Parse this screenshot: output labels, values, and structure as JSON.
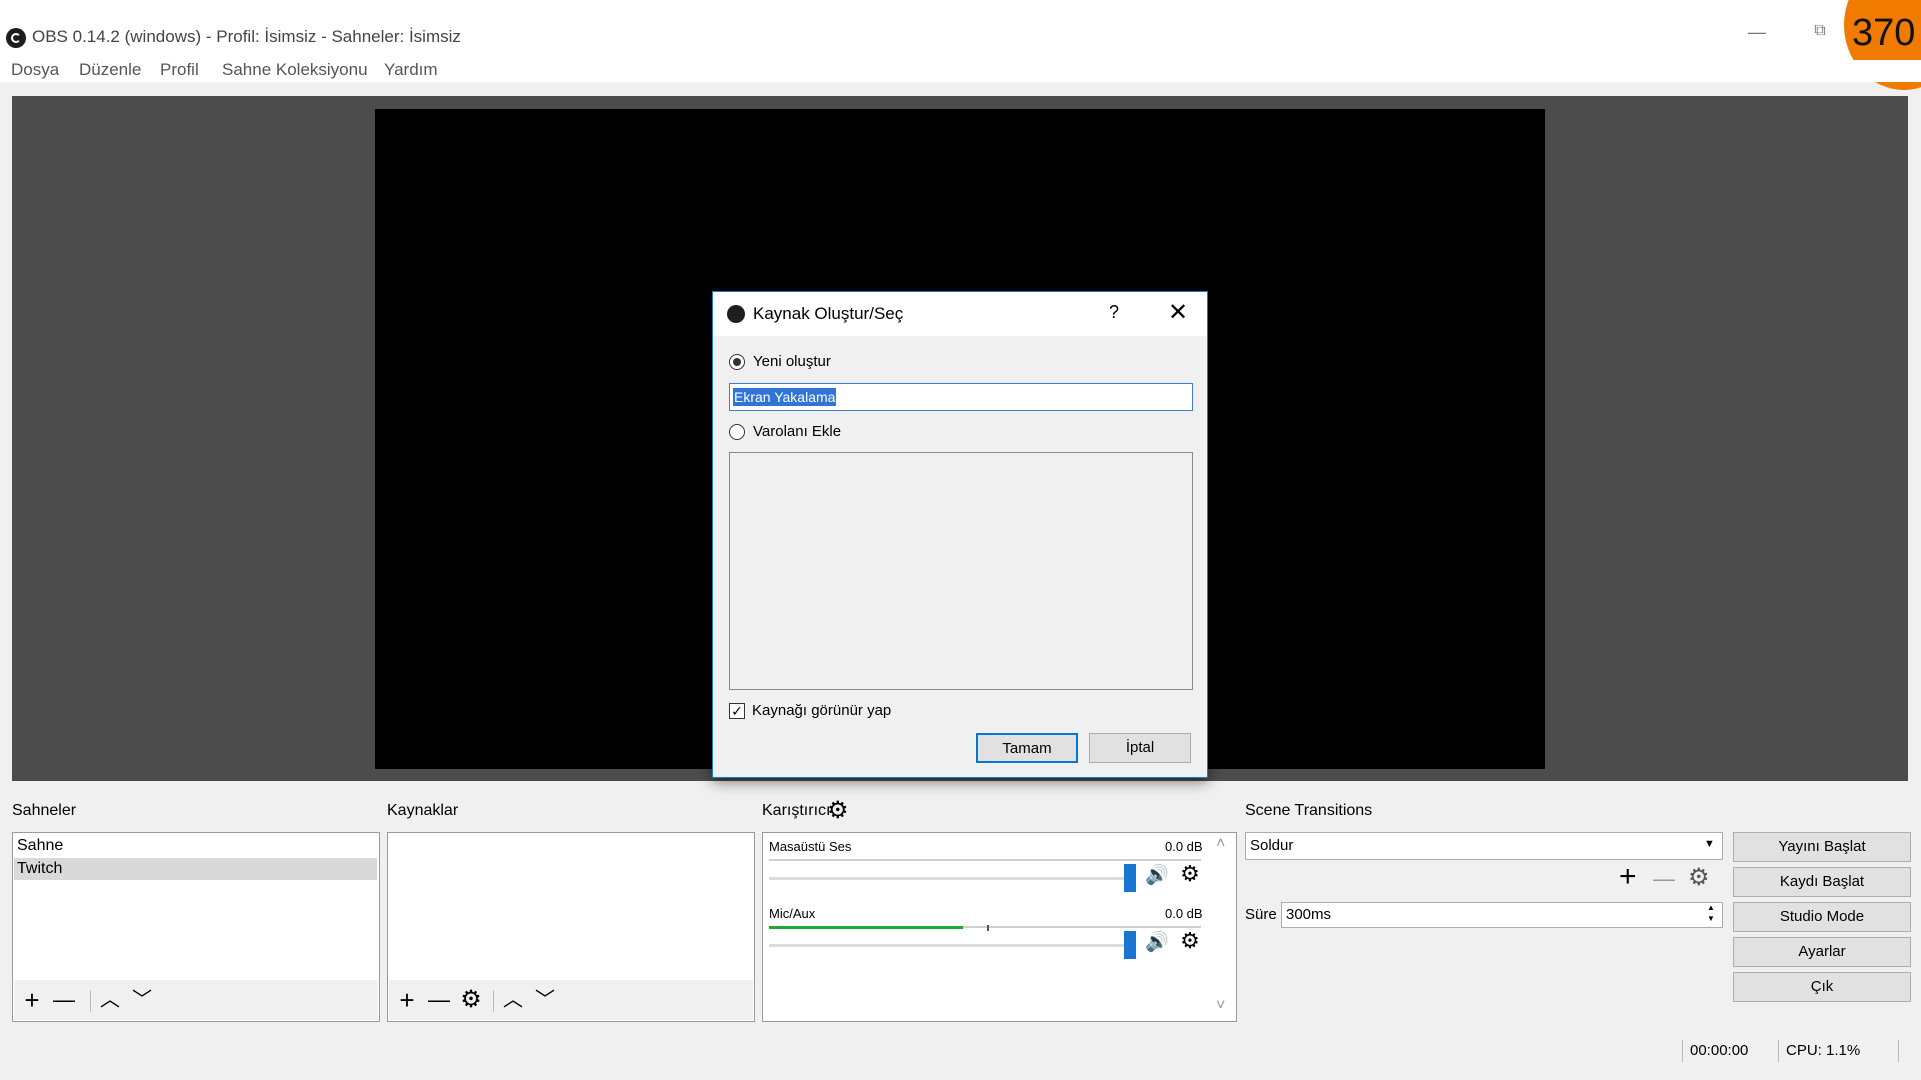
{
  "window": {
    "title": "OBS 0.14.2 (windows) - Profil: İsimsiz - Sahneler: İsimsiz",
    "minimize_glyph": "—",
    "restore_glyph": "⧉",
    "badge": "370"
  },
  "menu": [
    "Dosya",
    "Düzenle",
    "Profil",
    "Sahne Koleksiyonu",
    "Yardım"
  ],
  "dialog": {
    "title": "Kaynak Oluştur/Seç",
    "help_glyph": "?",
    "close_glyph": "✕",
    "create_new_label": "Yeni oluştur",
    "name_value": "Ekran Yakalama",
    "add_existing_label": "Varolanı Ekle",
    "make_visible_label": "Kaynağı görünür yap",
    "make_visible_checked": true,
    "ok_label": "Tamam",
    "cancel_label": "İptal"
  },
  "scenes": {
    "title": "Sahneler",
    "items": [
      "Sahne",
      "Twitch"
    ],
    "selected": "Twitch"
  },
  "sources": {
    "title": "Kaynaklar",
    "items": []
  },
  "mixer": {
    "title": "Karıştırıcı",
    "channels": [
      {
        "name": "Masaüstü Ses",
        "db": "0.0 dB",
        "level": 0.0
      },
      {
        "name": "Mic/Aux",
        "db": "0.0 dB",
        "level": 0.45
      }
    ]
  },
  "transitions": {
    "title": "Scene Transitions",
    "selected": "Soldur",
    "duration_label": "Süre",
    "duration_value": "300ms"
  },
  "controls": [
    "Yayını Başlat",
    "Kaydı Başlat",
    "Studio Mode",
    "Ayarlar",
    "Çık"
  ],
  "status": {
    "time": "00:00:00",
    "cpu": "CPU: 1.1%"
  },
  "icons": {
    "add": "+",
    "remove": "—",
    "up": "︿",
    "down": "﹀",
    "gear": "⚙",
    "speaker": "🔊",
    "check": "✓",
    "dropdown": "▼",
    "spin_up": "▲",
    "spin_down": "▼",
    "scroll_up": "˄",
    "scroll_down": "˅"
  },
  "colors": {
    "accent": "#0078d7",
    "preview_bg": "#4c4c4c",
    "meter_green": "#1cab2f",
    "badge": "#f07b00"
  }
}
